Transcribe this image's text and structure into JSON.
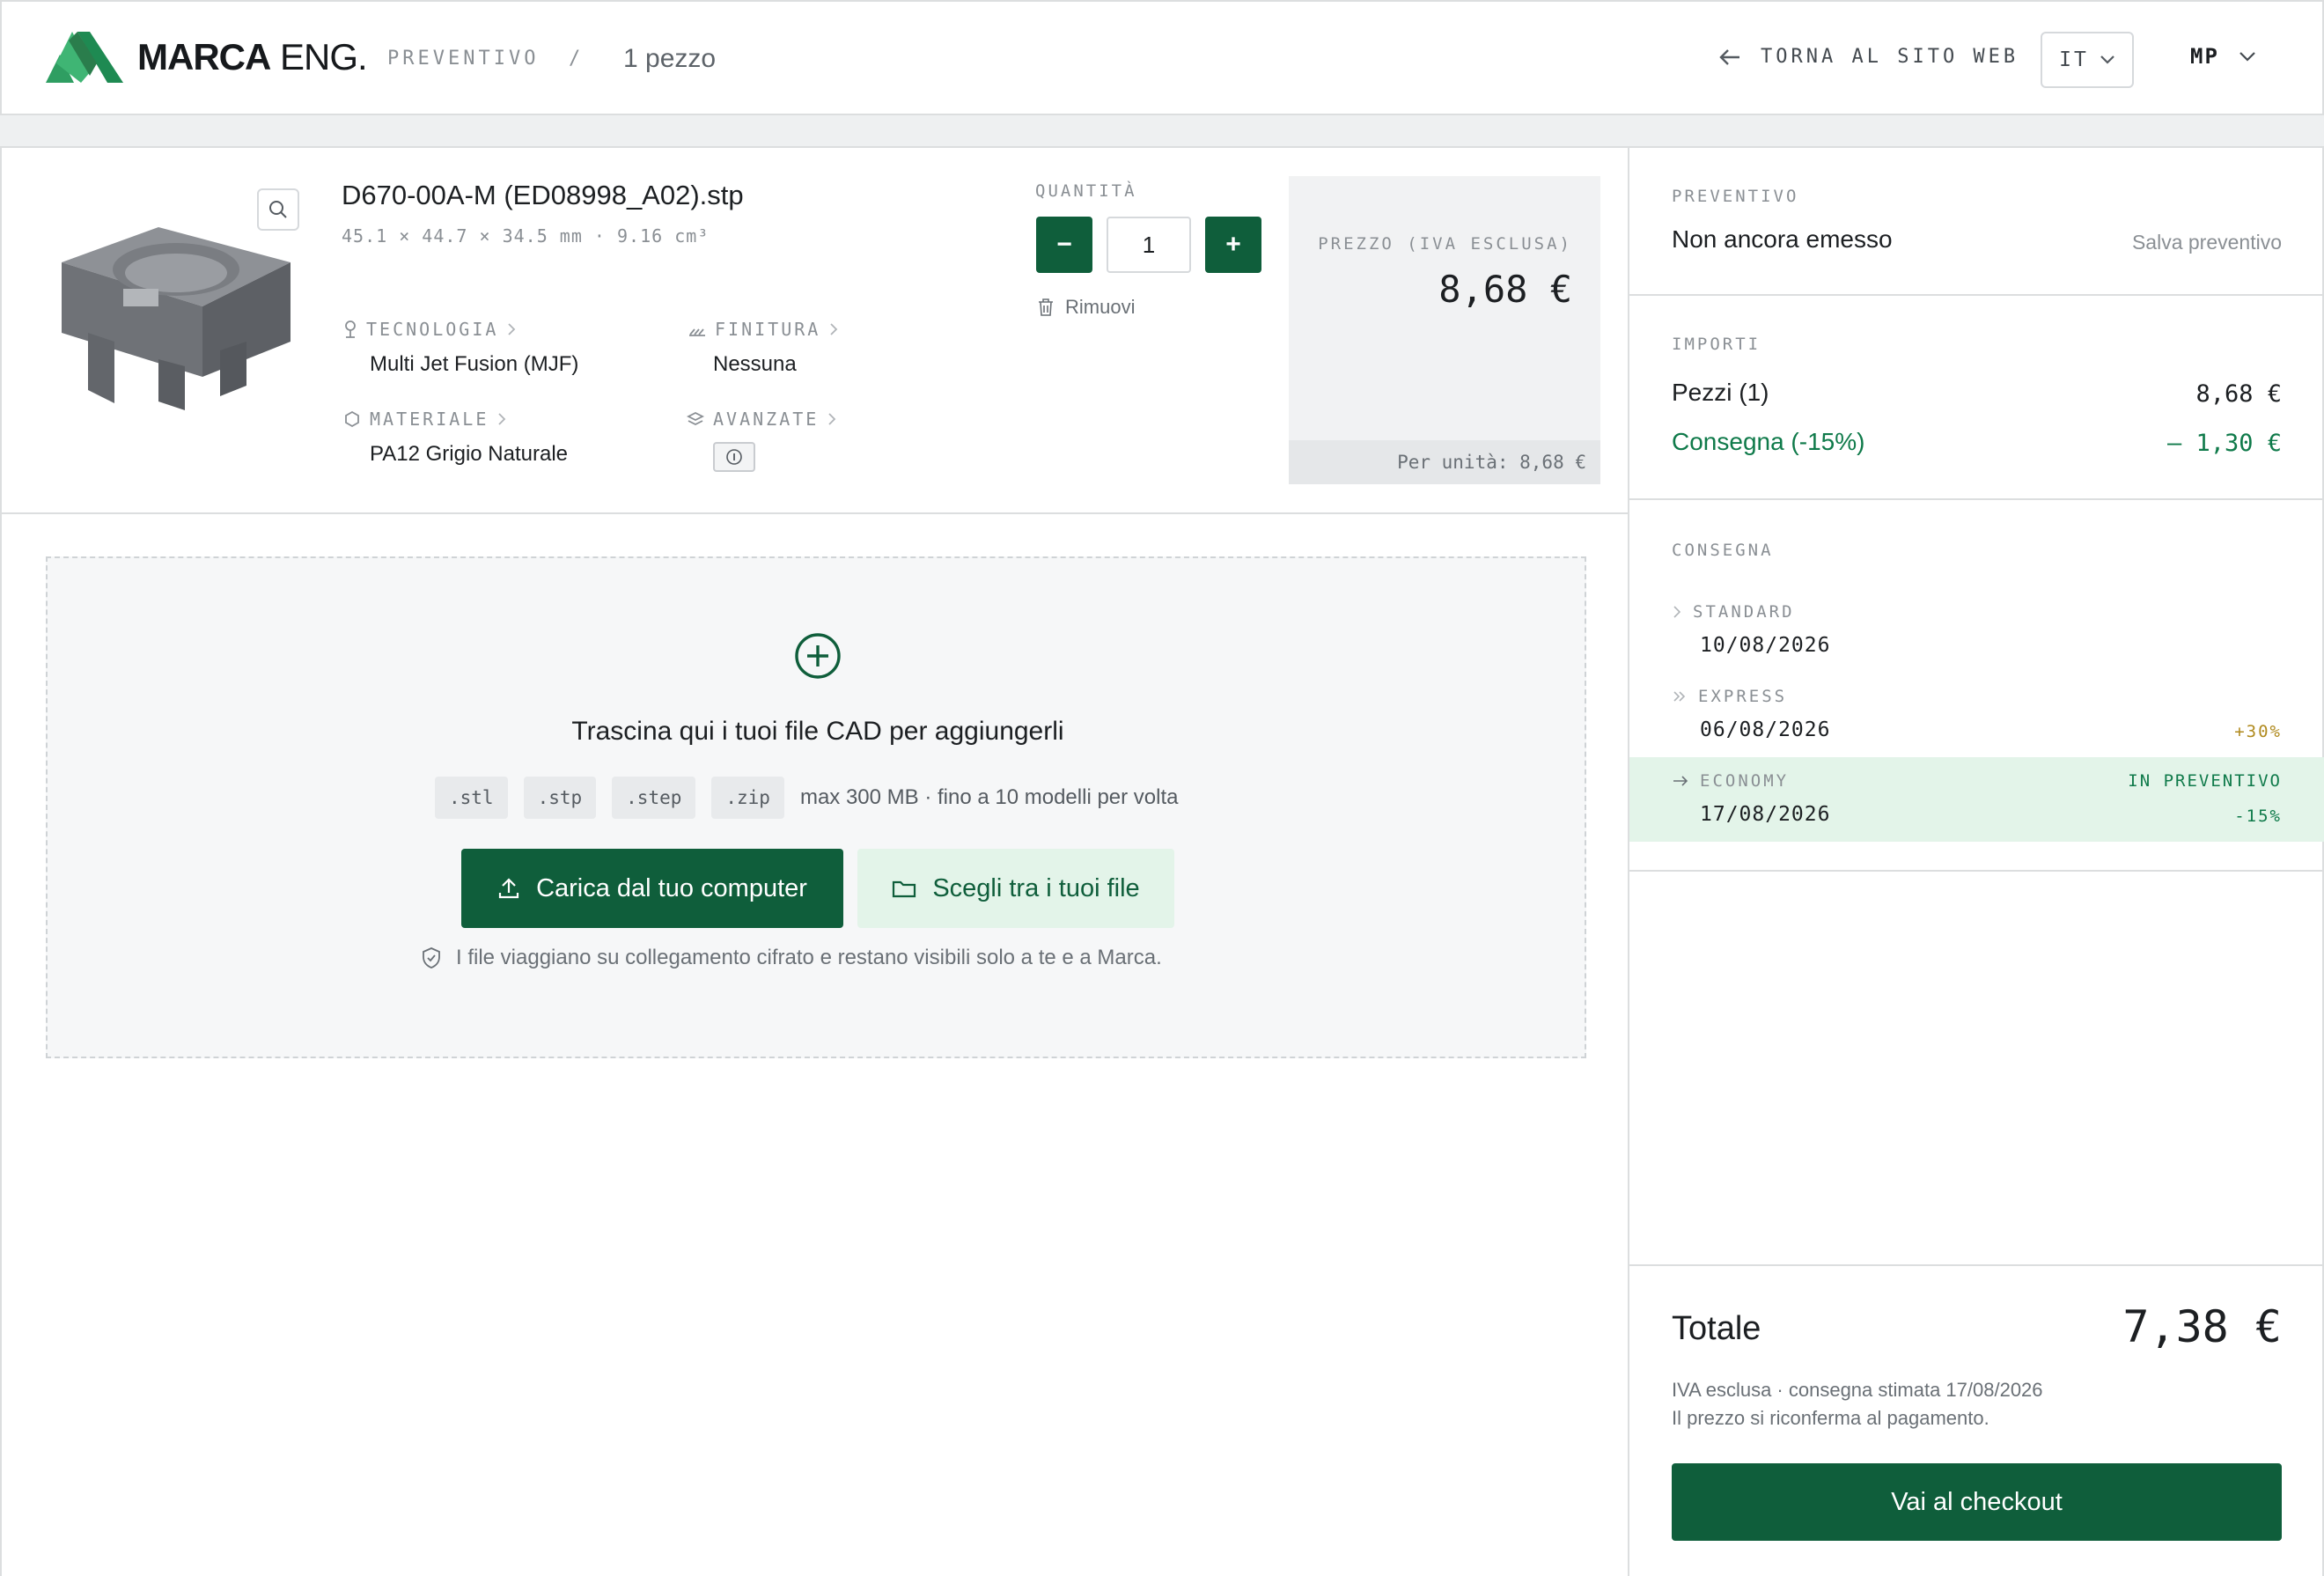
{
  "header": {
    "logo_text_bold": "MARCA",
    "logo_text_light": "ENG.",
    "breadcrumb_section": "PREVENTIVO",
    "breadcrumb_separator": "/",
    "breadcrumb_count": "1 pezzo",
    "back_link": "TORNA AL SITO WEB",
    "language": "IT",
    "user_initials": "MP"
  },
  "part": {
    "file_name": "D670-00A-M (ED08998_A02).stp",
    "dimensions": "45.1 × 44.7 × 34.5 mm · 9.16 cm³",
    "technology_label": "TECNOLOGIA",
    "technology_value": "Multi Jet Fusion (MJF)",
    "finish_label": "FINITURA",
    "finish_value": "Nessuna",
    "material_label": "MATERIALE",
    "material_value": "PA12 Grigio Naturale",
    "advanced_label": "AVANZATE",
    "quantity_label": "QUANTITÀ",
    "quantity_value": "1",
    "minus": "−",
    "plus": "+",
    "remove_label": "Rimuovi",
    "price_label": "PREZZO (IVA ESCLUSA)",
    "price_value": "8,68 €",
    "unit_price": "Per unità: 8,68 €"
  },
  "upload": {
    "title": "Trascina qui i tuoi file CAD per aggiungerli",
    "extensions": [
      ".stl",
      ".stp",
      ".step",
      ".zip"
    ],
    "note": "max 300 MB · fino a 10 modelli per volta",
    "primary_button": "Carica dal tuo computer",
    "secondary_button": "Scegli tra i tuoi file",
    "security_note": "I file viaggiano su collegamento cifrato e restano visibili solo a te e a Marca."
  },
  "sidebar": {
    "quote_label": "PREVENTIVO",
    "quote_status": "Non ancora emesso",
    "save_quote": "Salva preventivo",
    "amounts_label": "IMPORTI",
    "parts_label": "Pezzi (1)",
    "parts_value": "8,68 €",
    "delivery_discount_label": "Consegna (-15%)",
    "delivery_discount_value": "– 1,30 €",
    "delivery_label": "CONSEGNA",
    "delivery_options": [
      {
        "name": "STANDARD",
        "date": "10/08/2026",
        "tag": "",
        "note": ""
      },
      {
        "name": "EXPRESS",
        "date": "06/08/2026",
        "tag": "",
        "note": "+30%"
      },
      {
        "name": "ECONOMY",
        "date": "17/08/2026",
        "tag": "IN PREVENTIVO",
        "note": "-15%"
      }
    ],
    "total_label": "Totale",
    "total_value": "7,38 €",
    "total_note_1": "IVA esclusa · consegna stimata 17/08/2026",
    "total_note_2": "Il prezzo si riconferma al pagamento.",
    "checkout_button": "Vai al checkout"
  },
  "colors": {
    "brand_green": "#0f5e3b",
    "accent_green": "#0f7a4a",
    "logo_green": "#2f9e62",
    "highlight": "#e3f4e9",
    "warning_gold": "#b08a1e"
  }
}
